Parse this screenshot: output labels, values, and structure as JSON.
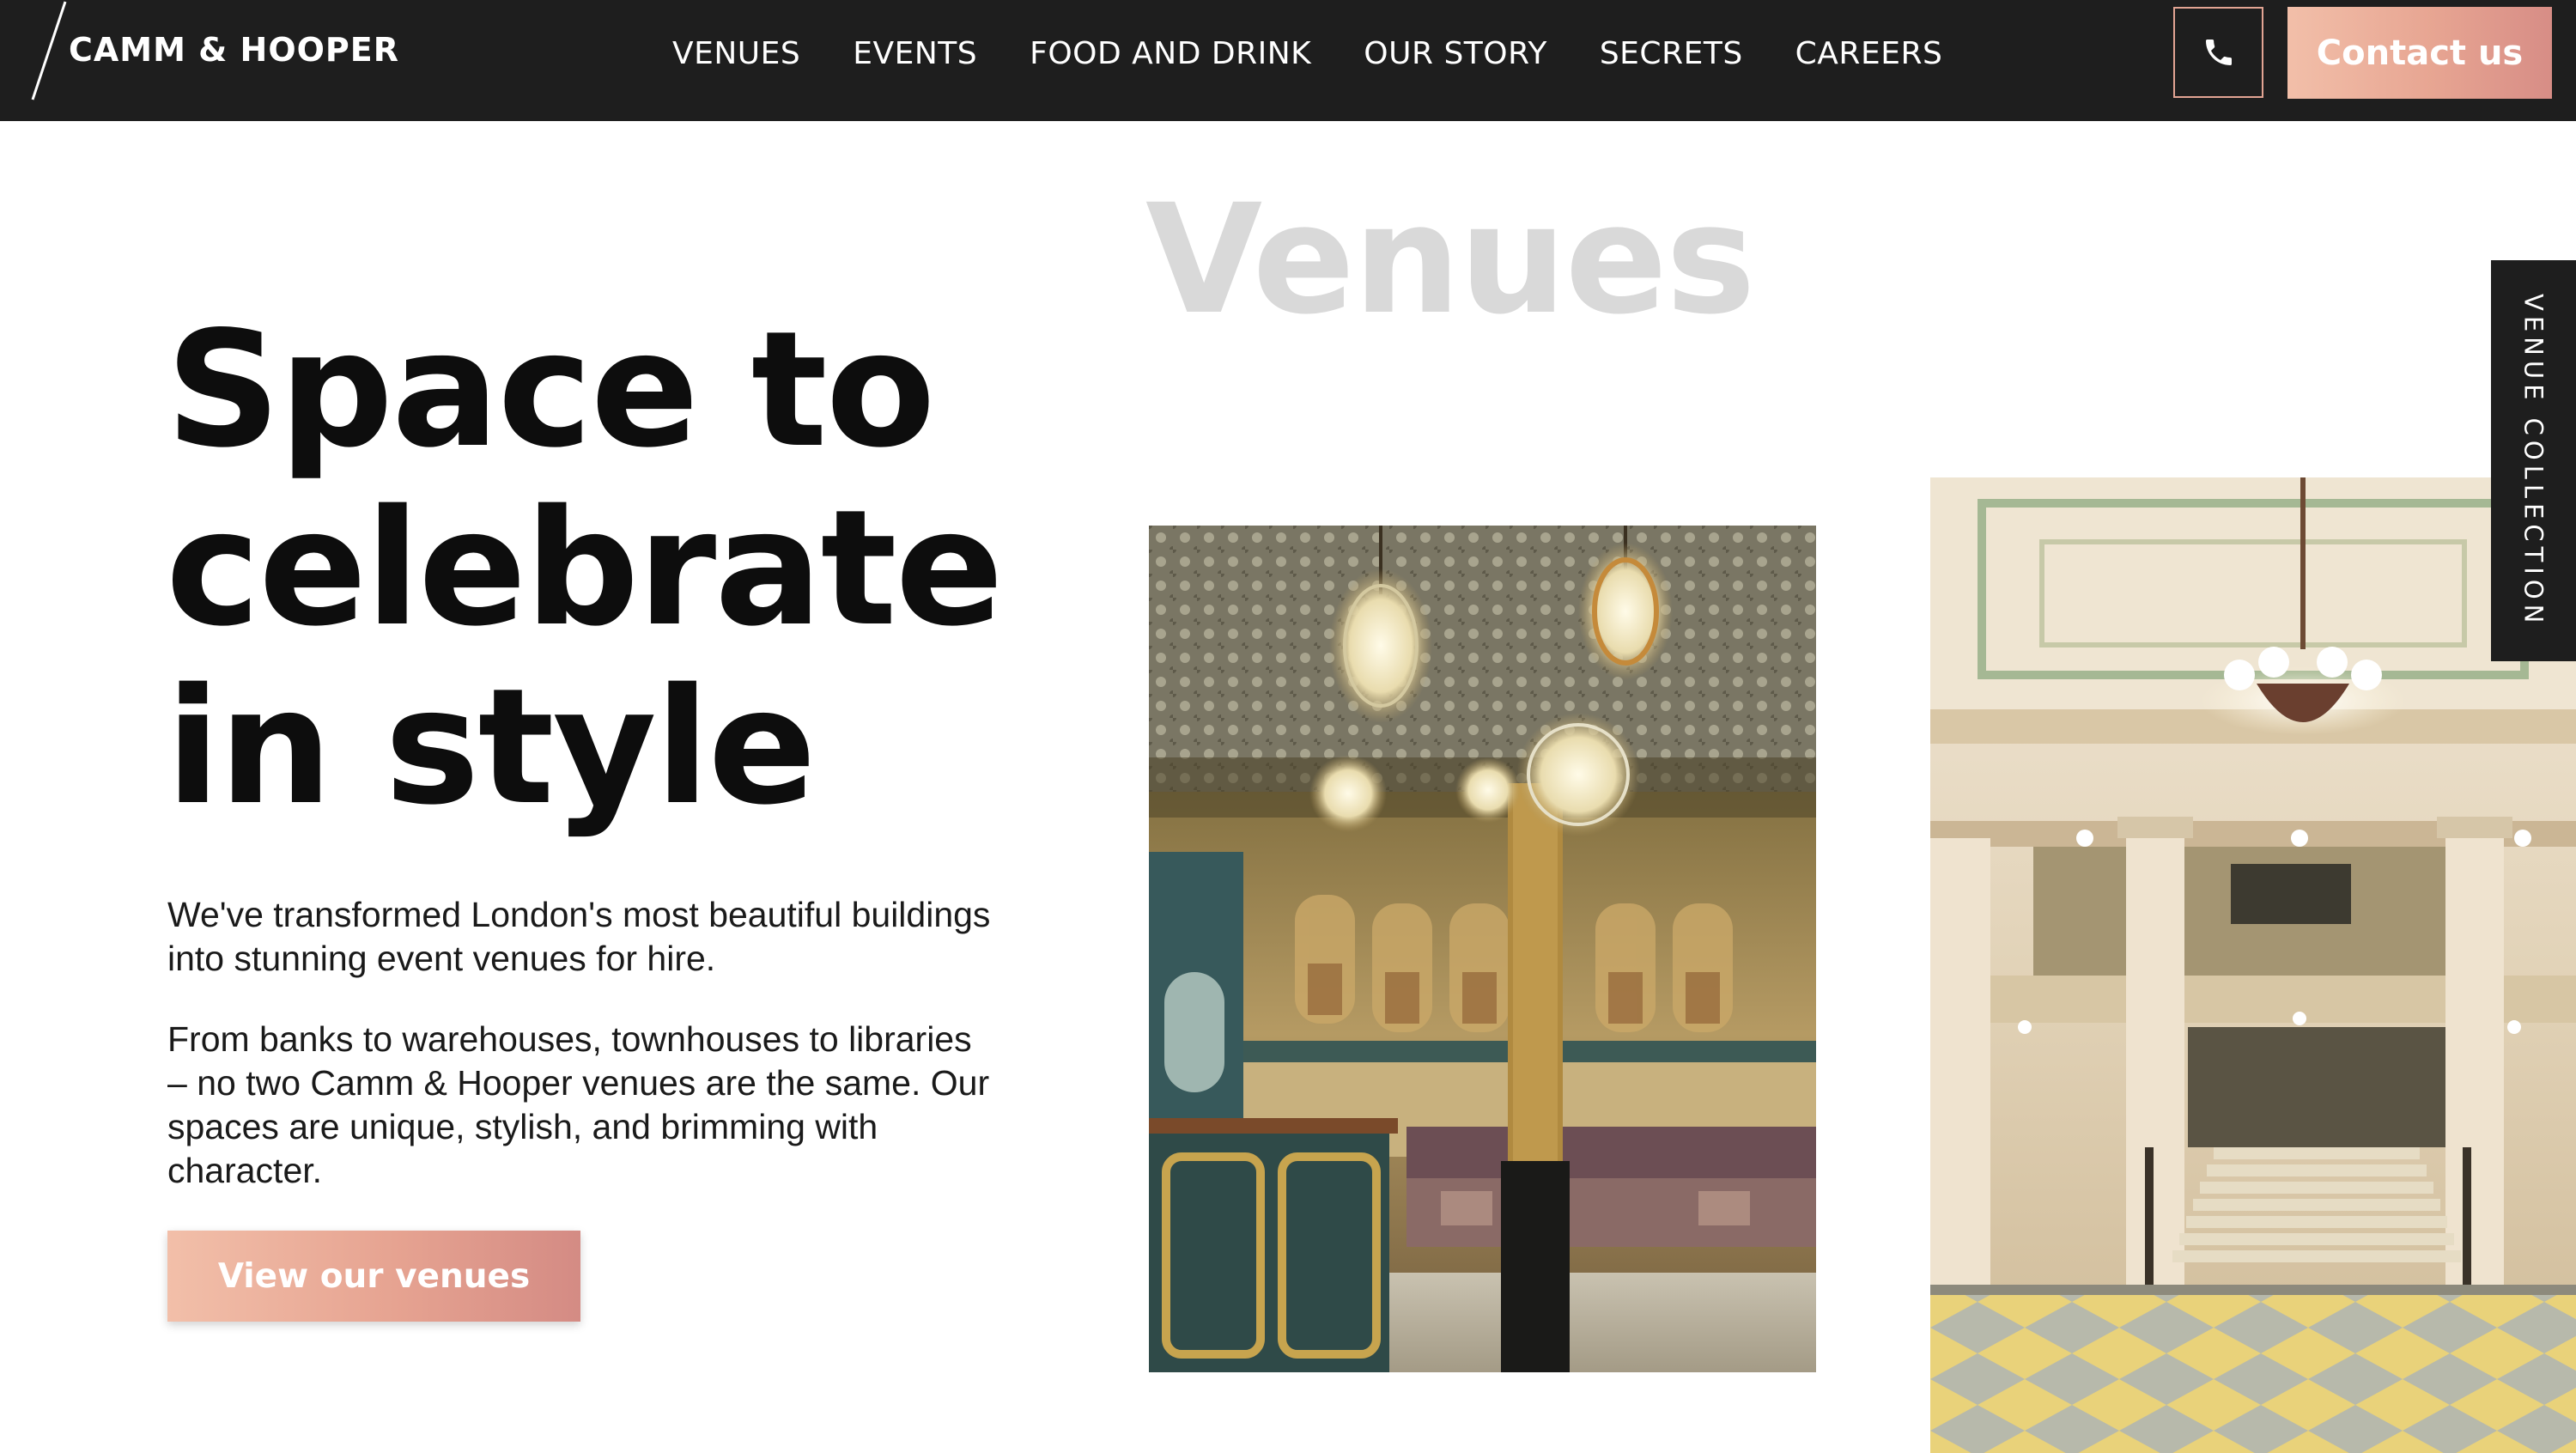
{
  "brand": {
    "name": "CAMM & HOOPER"
  },
  "nav": {
    "items": [
      {
        "label": "VENUES"
      },
      {
        "label": "EVENTS"
      },
      {
        "label": "FOOD AND DRINK"
      },
      {
        "label": "OUR STORY"
      },
      {
        "label": "SECRETS"
      },
      {
        "label": "CAREERS"
      }
    ]
  },
  "header": {
    "phone_icon": "phone-icon",
    "contact_label": "Contact us"
  },
  "hero": {
    "heading_lines": [
      "Space to",
      "celebrate",
      "in style"
    ],
    "paragraph_1": "We've transformed London's most beautiful buildings into stunning event venues for hire.",
    "paragraph_2": "From banks to warehouses, townhouses to libraries – no two Camm & Hooper venues are the same. Our spaces are unique, stylish, and brimming with character.",
    "cta_label": "View our venues"
  },
  "venues": {
    "section_title": "Venues",
    "side_tab_label": "VENUE COLLECTION"
  },
  "colors": {
    "header_bg": "#1e1e1e",
    "accent_gradient_start": "#f2bfa9",
    "accent_gradient_end": "#d48b84",
    "section_title": "#d9d9d9"
  }
}
